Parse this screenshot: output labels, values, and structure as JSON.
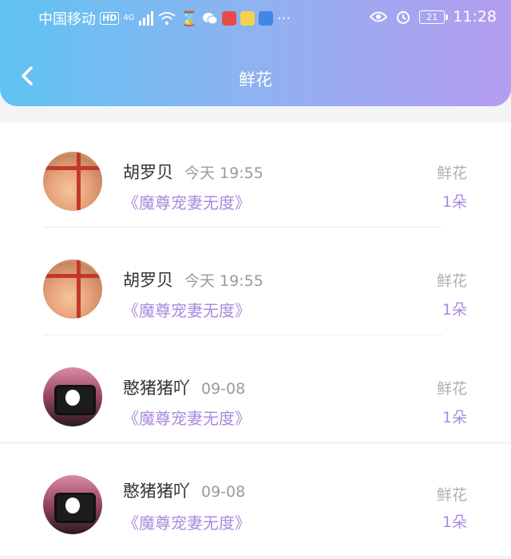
{
  "status_bar": {
    "carrier": "中国移动",
    "hd": "HD",
    "network": "4G",
    "battery": "21",
    "time": "11:28"
  },
  "header": {
    "title": "鲜花"
  },
  "items": [
    {
      "user": "胡罗贝",
      "time": "今天 19:55",
      "book": "《魔尊宠妻无度》",
      "gift": "鲜花",
      "count": "1朵"
    },
    {
      "user": "胡罗贝",
      "time": "今天 19:55",
      "book": "《魔尊宠妻无度》",
      "gift": "鲜花",
      "count": "1朵"
    },
    {
      "user": "憨猪猪吖",
      "time": "09-08",
      "book": "《魔尊宠妻无度》",
      "gift": "鲜花",
      "count": "1朵"
    },
    {
      "user": "憨猪猪吖",
      "time": "09-08",
      "book": "《魔尊宠妻无度》",
      "gift": "鲜花",
      "count": "1朵"
    }
  ],
  "colors": {
    "accent": "#a98be0",
    "header_start": "#5fc3f2",
    "header_end": "#b49cf0"
  }
}
